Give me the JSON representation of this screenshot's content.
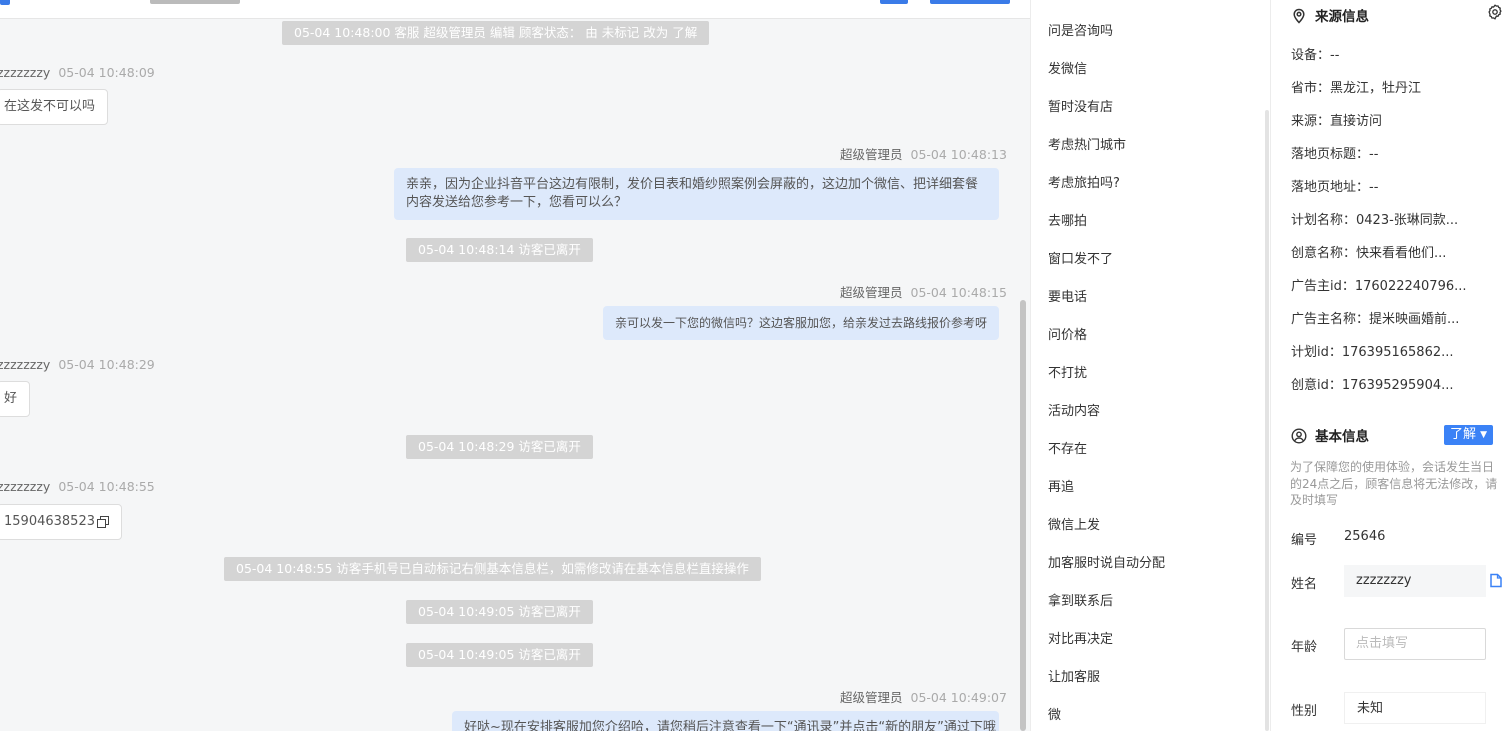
{
  "chat": {
    "messages": [
      {
        "kind": "system",
        "text": "05-04 10:48:00 客服 超级管理员 编辑 顾客状态： 由 未标记 改为 了解"
      },
      {
        "kind": "visitor",
        "name": "zzzzzzzy",
        "time": "05-04 10:48:09",
        "text": "在这发不可以吗"
      },
      {
        "kind": "agent",
        "name": "超级管理员",
        "time": "05-04 10:48:13",
        "text": "亲亲，因为企业抖音平台这边有限制，发价目表和婚纱照案例会屏蔽的，这边加个微信、把详细套餐内容发送给您参考一下，您看可以么？"
      },
      {
        "kind": "system",
        "text": "05-04 10:48:14 访客已离开"
      },
      {
        "kind": "agent",
        "name": "超级管理员",
        "time": "05-04 10:48:15",
        "text": "亲可以发一下您的微信吗？这边客服加您，给亲发过去路线报价参考呀"
      },
      {
        "kind": "visitor",
        "name": "zzzzzzzy",
        "time": "05-04 10:48:29",
        "text": "好"
      },
      {
        "kind": "system",
        "text": "05-04 10:48:29 访客已离开"
      },
      {
        "kind": "visitor",
        "name": "zzzzzzzy",
        "time": "05-04 10:48:55",
        "text": "15904638523"
      },
      {
        "kind": "system",
        "text": "05-04 10:48:55 访客手机号已自动标记右侧基本信息栏，如需修改请在基本信息栏直接操作"
      },
      {
        "kind": "system",
        "text": "05-04 10:49:05 访客已离开"
      },
      {
        "kind": "system",
        "text": "05-04 10:49:05 访客已离开"
      },
      {
        "kind": "agent",
        "name": "超级管理员",
        "time": "05-04 10:49:07",
        "text": "好哒~现在安排客服加您介绍哈，请您稍后注意查看一下“通讯录”并点击“新的朋友”通过下哦"
      }
    ]
  },
  "quick_phrases": [
    "问是咨询吗",
    "发微信",
    "暂时没有店",
    "考虑热门城市",
    "考虑旅拍吗?",
    "去哪拍",
    "窗口发不了",
    "要电话",
    "问价格",
    "不打扰",
    "活动内容",
    "不存在",
    "再追",
    "微信上发",
    "加客服时说自动分配",
    "拿到联系后",
    "对比再决定",
    "让加客服",
    "微"
  ],
  "source_info": {
    "title": "来源信息",
    "rows": [
      "设备：--",
      "省市：黑龙江，牡丹江",
      "来源：直接访问",
      "落地页标题：--",
      "落地页地址：--",
      "计划名称：0423-张琳同款...",
      "创意名称：快来看看他们...",
      "广告主id：176022240796...",
      "广告主名称：提米映画婚前...",
      "计划id：176395165862...",
      "创意id：176395295904..."
    ]
  },
  "basic_info": {
    "title": "基本信息",
    "status_badge": "了解",
    "note": "为了保障您的使用体验，会话发生当日的24点之后，顾客信息将无法修改，请及时填写",
    "id_label": "编号",
    "id_value": "25646",
    "name_label": "姓名",
    "name_value": "zzzzzzzy",
    "age_label": "年龄",
    "age_placeholder": "点击填写",
    "gender_label": "性别",
    "gender_value": "未知"
  },
  "colors": {
    "accent": "#3b82f6",
    "agent_bubble": "#dde9fb",
    "system_chip": "#d4d4d4",
    "chat_bg": "#f5f6f7"
  }
}
